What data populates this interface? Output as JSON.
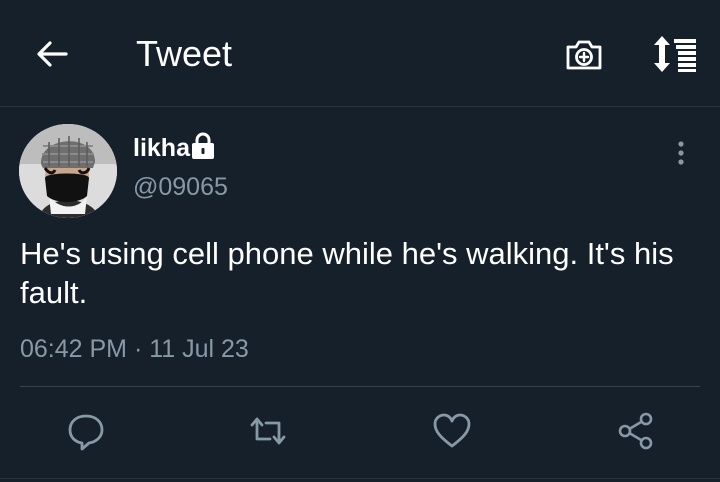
{
  "header": {
    "title": "Tweet",
    "icons": [
      "back-arrow-icon",
      "camera-plus-icon",
      "sort-icon"
    ]
  },
  "author": {
    "display_name": "likha",
    "handle": "@09065",
    "protected_icon": "lock-icon",
    "avatar": "avatar-photo"
  },
  "tweet": {
    "text": "He's using cell phone while he's walking. It's his fault.",
    "timestamp": "06:42 PM · 11 Jul 23"
  },
  "actions": [
    "reply-icon",
    "retweet-icon",
    "like-icon",
    "share-icon"
  ],
  "colors": {
    "background": "#15202b",
    "text": "#ffffff",
    "secondary": "#8899a6",
    "divider": "#38444d"
  }
}
